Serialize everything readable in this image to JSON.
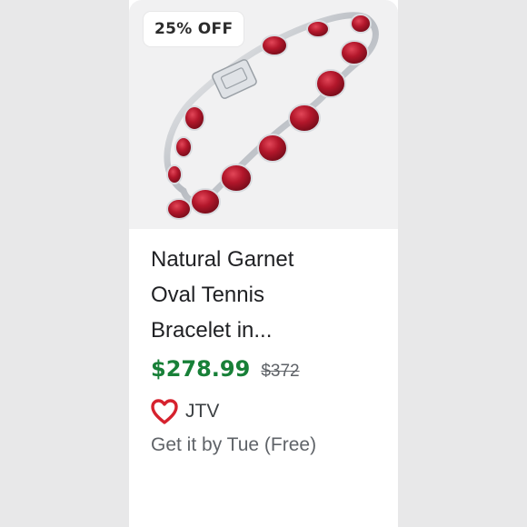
{
  "badge": {
    "label": "25% OFF"
  },
  "product": {
    "title_line1": "Natural Garnet",
    "title_line2": "Oval Tennis",
    "title_line3": "Bracelet in...",
    "price": "$278.99",
    "original_price": "$372"
  },
  "seller": {
    "name": "JTV",
    "logo_icon": "heart-logo-icon"
  },
  "delivery": {
    "text": "Get it by Tue (Free)"
  },
  "colors": {
    "price_green": "#188038",
    "garnet_red": "#b3172b",
    "seller_logo_red": "#d6222e"
  }
}
